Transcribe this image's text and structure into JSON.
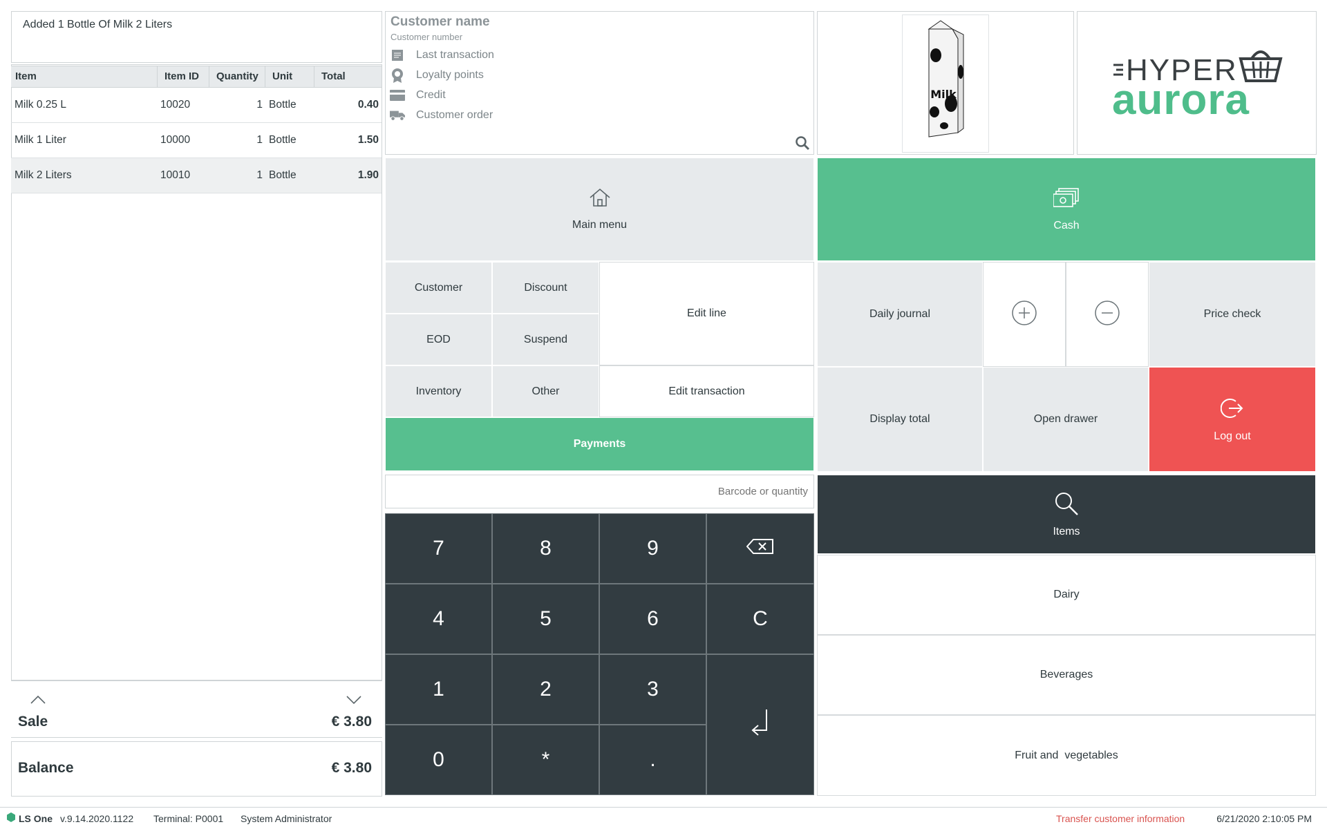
{
  "message": "Added 1 Bottle Of Milk 2 Liters",
  "table": {
    "headers": [
      "Item",
      "Item ID",
      "Quantity",
      "Unit",
      "Total"
    ],
    "rows": [
      {
        "item": "Milk 0.25 L",
        "id": "10020",
        "qty": "1",
        "unit": "Bottle",
        "total": "0.40"
      },
      {
        "item": "Milk 1 Liter",
        "id": "10000",
        "qty": "1",
        "unit": "Bottle",
        "total": "1.50"
      },
      {
        "item": "Milk 2 Liters",
        "id": "10010",
        "qty": "1",
        "unit": "Bottle",
        "total": "1.90"
      }
    ]
  },
  "totals": {
    "sale_label": "Sale",
    "sale_value": "€ 3.80",
    "balance_label": "Balance",
    "balance_value": "€ 3.80"
  },
  "customer": {
    "name": "Customer name",
    "number": "Customer number",
    "links": [
      "Last transaction",
      "Loyalty points",
      "Credit",
      "Customer order"
    ]
  },
  "product_image": {
    "label": "Milk"
  },
  "logo": {
    "top": "HYPER",
    "bottom": "aurora"
  },
  "buttons": {
    "main_menu": "Main menu",
    "cash": "Cash",
    "customer": "Customer",
    "discount": "Discount",
    "edit_line": "Edit line",
    "eod": "EOD",
    "suspend": "Suspend",
    "inventory": "Inventory",
    "other": "Other",
    "edit_transaction": "Edit transaction",
    "payments": "Payments",
    "daily_journal": "Daily journal",
    "price_check": "Price check",
    "display_total": "Display total",
    "open_drawer": "Open drawer",
    "log_out": "Log out",
    "items": "Items",
    "dairy": "Dairy",
    "beverages": "Beverages",
    "fruit": "Fruit and  vegetables"
  },
  "input": {
    "placeholder": "Barcode or quantity"
  },
  "keypad": {
    "k7": "7",
    "k8": "8",
    "k9": "9",
    "k4": "4",
    "k5": "5",
    "k6": "6",
    "kc": "C",
    "k1": "1",
    "k2": "2",
    "k3": "3",
    "k0": "0",
    "kstar": "*",
    "kdot": "."
  },
  "statusbar": {
    "brand": "LS One",
    "version": "v.9.14.2020.1122",
    "terminal": "Terminal: P0001",
    "user": "System Administrator",
    "transfer": "Transfer customer information",
    "datetime": "6/21/2020 2:10:05 PM"
  },
  "colors": {
    "green": "#57bf8f",
    "red": "#ef5353",
    "dark": "#323c41",
    "grey": "#e7eaec",
    "status_link": "#d9534f"
  }
}
